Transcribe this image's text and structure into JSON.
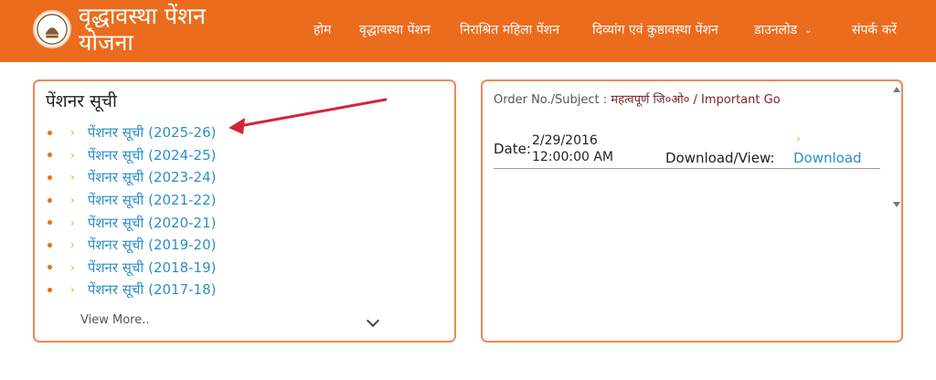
{
  "header": {
    "site_title": "वृद्धावस्था पेंशन योजना",
    "logo_icon": "up-govt-emblem-icon",
    "nav": [
      {
        "label": "होम"
      },
      {
        "label": "वृद्धावस्था पेंशन"
      },
      {
        "label": "निराश्रित महिला पेंशन"
      },
      {
        "label": "दिव्यांग एवं कुष्ठावस्था पेंशन"
      },
      {
        "label": "डाउनलोड",
        "dropdown": true
      },
      {
        "label": "संपर्क करें"
      }
    ]
  },
  "pensioner_panel": {
    "title": "पेंशनर सूची",
    "items": [
      {
        "label": "पेंशनर सूची",
        "year": "(2025-26)"
      },
      {
        "label": "पेंशनर सूची",
        "year": "(2024-25)"
      },
      {
        "label": "पेंशनर सूची",
        "year": "(2023-24)"
      },
      {
        "label": "पेंशनर सूची",
        "year": "(2021-22)"
      },
      {
        "label": "पेंशनर सूची",
        "year": "(2020-21)"
      },
      {
        "label": "पेंशनर सूची",
        "year": "(2019-20)"
      },
      {
        "label": "पेंशनर सूची",
        "year": "(2018-19)"
      },
      {
        "label": "पेंशनर सूची",
        "year": "(2017-18)"
      }
    ],
    "view_more": "View More.."
  },
  "order_panel": {
    "order_label": "Order No./Subject :",
    "subject": "महत्वपूर्ण जि०ओ० / Important Go",
    "date_label": "Date:",
    "date_line1": "2/29/2016",
    "date_line2": "12:00:00 AM",
    "download_label": "Download/View:",
    "download_link": "Download"
  },
  "colors": {
    "header_bg": "#ec6c1e",
    "panel_border": "#ec8a52",
    "link": "#2b8fc7",
    "annotation_arrow": "#d4243a"
  }
}
